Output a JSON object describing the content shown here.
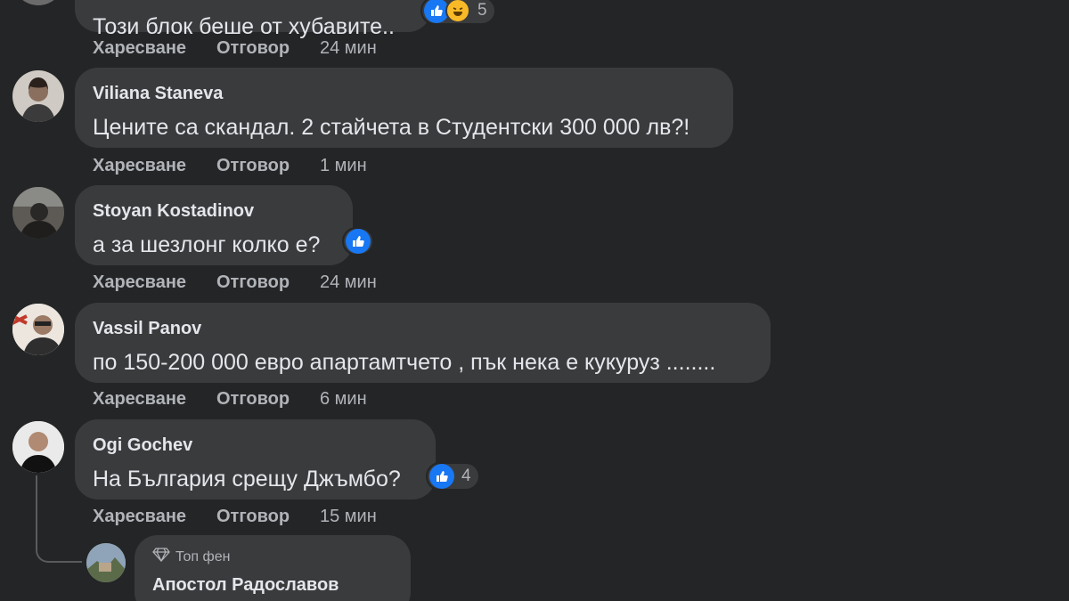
{
  "actions": {
    "like": "Харесване",
    "reply": "Отговор"
  },
  "comments": [
    {
      "author": "",
      "text": "Този блок беше от хубавите..",
      "time": "24 мин",
      "reactions": [
        "like",
        "haha"
      ],
      "reaction_count": "5"
    },
    {
      "author": "Viliana Staneva",
      "text": "Цените са скандал. 2 стайчета в Студентски 300 000 лв?!",
      "time": "1 мин"
    },
    {
      "author": "Stoyan Kostadinov",
      "text": "а за шезлонг колко е?",
      "time": "24 мин",
      "reactions": [
        "like"
      ]
    },
    {
      "author": "Vassil Panov",
      "text": "по 150-200 000 евро апартамтчето , пък нека е кукуруз ........",
      "time": "6 мин"
    },
    {
      "author": "Ogi Gochev",
      "text": "На България срещу Джъмбо?",
      "time": "15 мин",
      "reactions": [
        "like"
      ],
      "reaction_count": "4"
    }
  ],
  "reply": {
    "badge": "Топ фен",
    "author": "Апостол Радославов"
  },
  "icons": {
    "like": "thumbs-up-icon",
    "haha": "laughing-emoji-icon",
    "badge": "diamond-icon"
  },
  "colors": {
    "background": "#242526",
    "bubble": "#3a3b3c",
    "like": "#1877f2",
    "haha": "#f7b928"
  }
}
